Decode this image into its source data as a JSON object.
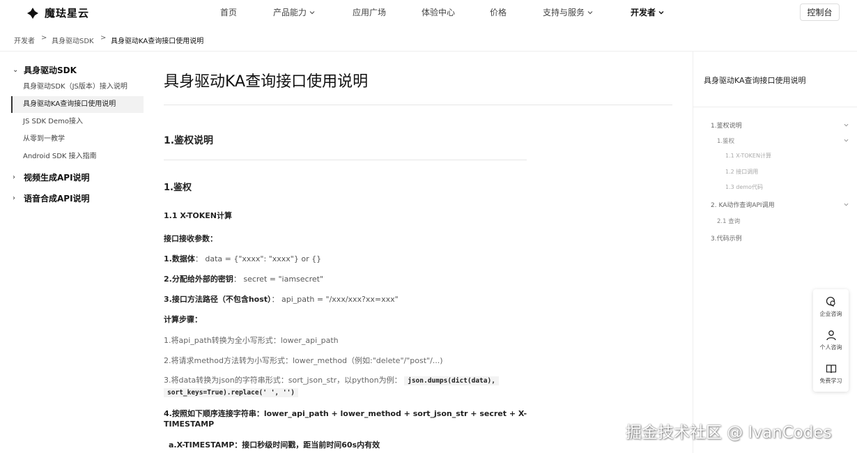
{
  "brand": {
    "name": "魔珐星云"
  },
  "nav": {
    "items": [
      {
        "label": "首页",
        "dropdown": false,
        "active": false
      },
      {
        "label": "产品能力",
        "dropdown": true,
        "active": false
      },
      {
        "label": "应用广场",
        "dropdown": false,
        "active": false
      },
      {
        "label": "体验中心",
        "dropdown": false,
        "active": false
      },
      {
        "label": "价格",
        "dropdown": false,
        "active": false
      },
      {
        "label": "支持与服务",
        "dropdown": true,
        "active": false
      },
      {
        "label": "开发者",
        "dropdown": true,
        "active": true
      }
    ],
    "console_label": "控制台"
  },
  "breadcrumb": {
    "items": [
      "开发者",
      "具身驱动SDK",
      "具身驱动KA查询接口使用说明"
    ],
    "separator": ">"
  },
  "sidebar": {
    "groups": [
      {
        "label": "具身驱动SDK",
        "expanded": true,
        "items": [
          {
            "label": "具身驱动SDK（JS版本）接入说明",
            "active": false
          },
          {
            "label": "具身驱动KA查询接口使用说明",
            "active": true
          },
          {
            "label": "JS SDK Demo接入",
            "active": false
          },
          {
            "label": "从零到一教学",
            "active": false
          },
          {
            "label": "Android SDK 接入指南",
            "active": false
          }
        ]
      },
      {
        "label": "视频生成API说明",
        "expanded": false
      },
      {
        "label": "语音合成API说明",
        "expanded": false
      }
    ],
    "expanded_glyph": "⌄",
    "collapsed_glyph": "›"
  },
  "article": {
    "title": "具身驱动KA查询接口使用说明",
    "h2": "1.鉴权说明",
    "h3": "1.鉴权",
    "h4": "1.1 X-TOKEN计算",
    "params_heading": "接口接收参数：",
    "params": [
      {
        "key": "1.数据体",
        "sep": "：",
        "value": "data = {\"xxxx\": \"xxxx\"} or {}"
      },
      {
        "key": "2.分配给外部的密钥",
        "sep": "：",
        "value": "secret = \"iamsecret\""
      },
      {
        "key": "3.接口方法路径（不包含host）",
        "sep": "：",
        "value": "api_path = \"/xxx/xxx?xx=xxx\""
      }
    ],
    "steps_heading": "计算步骤：",
    "steps": [
      "1.将api_path转换为全小写形式：lower_api_path",
      "2.将请求method方法转为小写形式：lower_method（例如:\"delete\"/\"post\"/...)",
      "3.将data转换为json的字符串形式：sort_json_str，以python为例："
    ],
    "code_a": "json.dumps(dict(data),",
    "code_b": "sort_keys=True).replace(' ', '')",
    "step4_a": "4.按照如下顺序连接字符串：lower_api_path + lower_method + sort_json_str + secret + X-",
    "step4_b": "TIMESTAMP",
    "sub_a": "a.X-TIMESTAMP：接口秒级时间戳，距当前时间60s内有效"
  },
  "toc": {
    "title": "具身驱动KA查询接口使用说明",
    "items": [
      {
        "label": "1.鉴权说明",
        "level": 1,
        "expandable": true
      },
      {
        "label": "1.鉴权",
        "level": 2,
        "expandable": true
      },
      {
        "label": "1.1 X-TOKEN计算",
        "level": 3,
        "expandable": false
      },
      {
        "label": "1.2 接口调用",
        "level": 3,
        "expandable": false
      },
      {
        "label": "1.3 demo代码",
        "level": 3,
        "expandable": false
      },
      {
        "label": "2. KA动作查询API调用",
        "level": 1,
        "expandable": true
      },
      {
        "label": "2.1 查询",
        "level": 2,
        "expandable": false
      },
      {
        "label": "3.代码示例",
        "level": 1,
        "expandable": false
      }
    ]
  },
  "float_panel": {
    "items": [
      {
        "label": "企业咨询",
        "icon": "chat-bubble-icon"
      },
      {
        "label": "个人咨询",
        "icon": "user-icon"
      },
      {
        "label": "免费学习",
        "icon": "book-icon"
      }
    ]
  },
  "watermark": "掘金技术社区 @ IvanCodes"
}
